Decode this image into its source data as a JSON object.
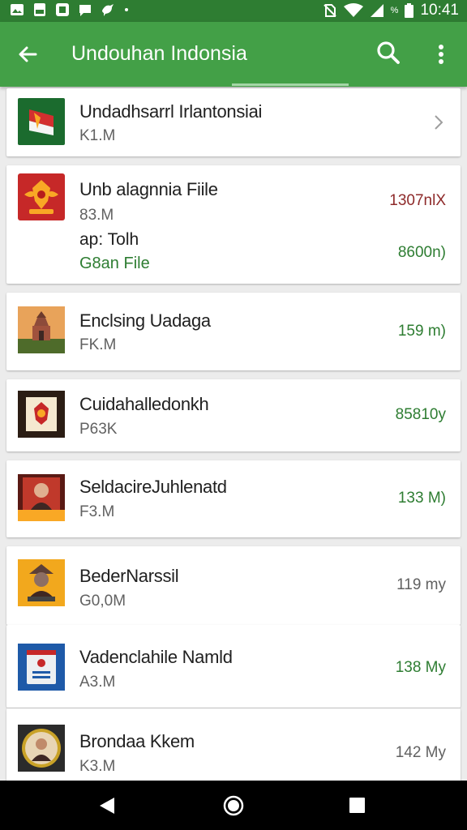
{
  "status_bar": {
    "time": "10:41",
    "battery_percent": "%",
    "icons": [
      "gallery-icon",
      "sd-card-icon",
      "screenshot-icon",
      "chat-icon",
      "bird-icon",
      "no-sim-icon",
      "wifi-icon",
      "signal-icon",
      "battery-icon"
    ]
  },
  "app_bar": {
    "title": "Undouhan Indonsia",
    "back_icon": "arrow-back-icon",
    "search_icon": "search-icon",
    "more_icon": "more-vert-icon"
  },
  "colors": {
    "status_bar": "#2e7d32",
    "app_bar": "#43a047",
    "accent_green": "#2e7d32",
    "accent_red": "#8e2a2a"
  },
  "items": [
    {
      "title": "Undadhsarrl Irlantonsiai",
      "sub": "K1.M",
      "meta": "",
      "chevron": true
    },
    {
      "title": "Unb alagnnia Fiile",
      "sub": "83.M",
      "extra": "ap: Tolh",
      "link": "G8an File",
      "meta_top": "1307nlX",
      "meta_bottom": "8600n)"
    },
    {
      "title": "Enclsing Uadaga",
      "sub": "FK.M",
      "meta": "159 m)"
    },
    {
      "title": "Cuidahalledonkh",
      "sub": "P63K",
      "meta": "85810y"
    },
    {
      "title": "SeldacireJuhlenatd",
      "sub": "F3.M",
      "meta": "133 M)"
    },
    {
      "title": "BederNarssil",
      "sub": "G0,0M",
      "meta": "119 my"
    },
    {
      "title": "Vadenclahile Namld",
      "sub": "A3.M",
      "meta": "138 My"
    },
    {
      "title": "Brondaa Kkem",
      "sub": "K3.M",
      "meta": "142 My"
    }
  ],
  "nav_bar": {
    "back_icon": "nav-back-icon",
    "home_icon": "nav-home-icon",
    "recents_icon": "nav-recents-icon"
  }
}
